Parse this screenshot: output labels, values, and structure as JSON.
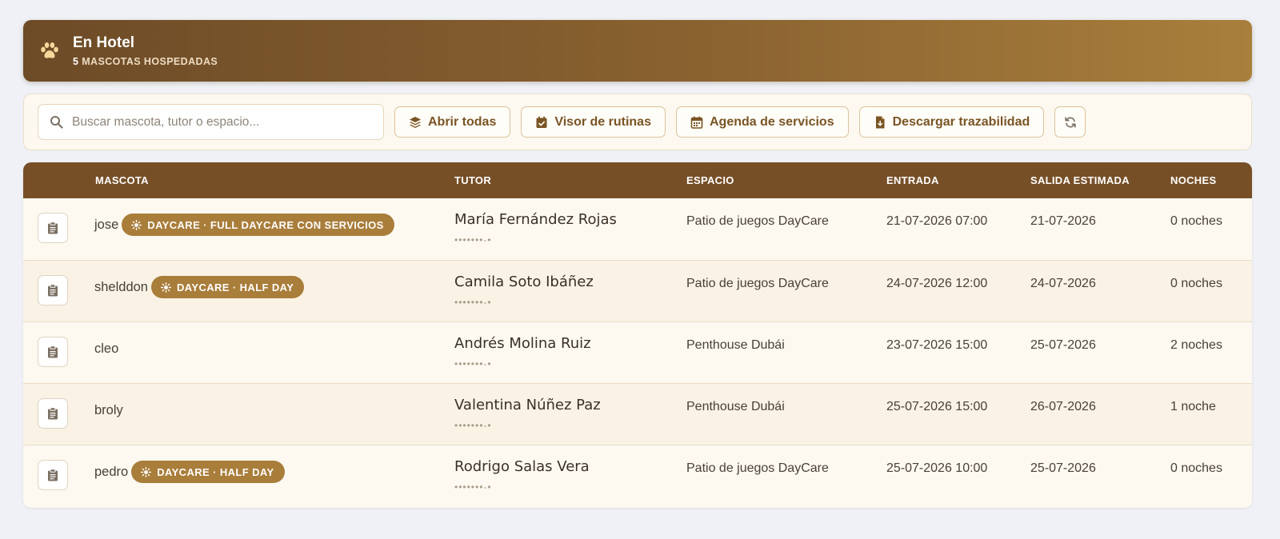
{
  "header": {
    "title": "En Hotel",
    "count": "5",
    "subtitle": "MASCOTAS HOSPEDADAS",
    "icon": "paw-icon"
  },
  "toolbar": {
    "search_placeholder": "Buscar mascota, tutor o espacio...",
    "search_value": "",
    "buttons": {
      "open_all": "Abrir todas",
      "routines": "Visor de rutinas",
      "services": "Agenda de servicios",
      "download": "Descargar trazabilidad"
    }
  },
  "table": {
    "columns": {
      "pet": "MASCOTA",
      "tutor": "TUTOR",
      "space": "ESPACIO",
      "entry": "ENTRADA",
      "exit": "SALIDA ESTIMADA",
      "nights": "NOCHES"
    },
    "rows": [
      {
        "pet": "jose",
        "badge": "DAYCARE · FULL DAYCARE CON SERVICIOS",
        "tutor": "María Fernández Rojas",
        "tutor_sub": "•••••••-•",
        "space": "Patio de juegos DayCare",
        "entry": "21-07-2026 07:00",
        "exit": "21-07-2026",
        "nights": "0 noches"
      },
      {
        "pet": "shelddon",
        "badge": "DAYCARE · HALF DAY",
        "tutor": "Camila Soto Ibáñez",
        "tutor_sub": "•••••••-•",
        "space": "Patio de juegos DayCare",
        "entry": "24-07-2026 12:00",
        "exit": "24-07-2026",
        "nights": "0 noches"
      },
      {
        "pet": "cleo",
        "badge": "",
        "tutor": "Andrés Molina Ruiz",
        "tutor_sub": "•••••••-•",
        "space": "Penthouse Dubái",
        "entry": "23-07-2026 15:00",
        "exit": "25-07-2026",
        "nights": "2 noches"
      },
      {
        "pet": "broly",
        "badge": "",
        "tutor": "Valentina Núñez Paz",
        "tutor_sub": "•••••••-•",
        "space": "Penthouse Dubái",
        "entry": "25-07-2026 15:00",
        "exit": "26-07-2026",
        "nights": "1 noche"
      },
      {
        "pet": "pedro",
        "badge": "DAYCARE · HALF DAY",
        "tutor": "Rodrigo Salas Vera",
        "tutor_sub": "•••••••-•",
        "space": "Patio de juegos DayCare",
        "entry": "25-07-2026 10:00",
        "exit": "25-07-2026",
        "nights": "0 noches"
      }
    ]
  },
  "colors": {
    "brand_dark": "#774f27",
    "brand_accent": "#a97d3a",
    "button_text": "#7a5424"
  }
}
